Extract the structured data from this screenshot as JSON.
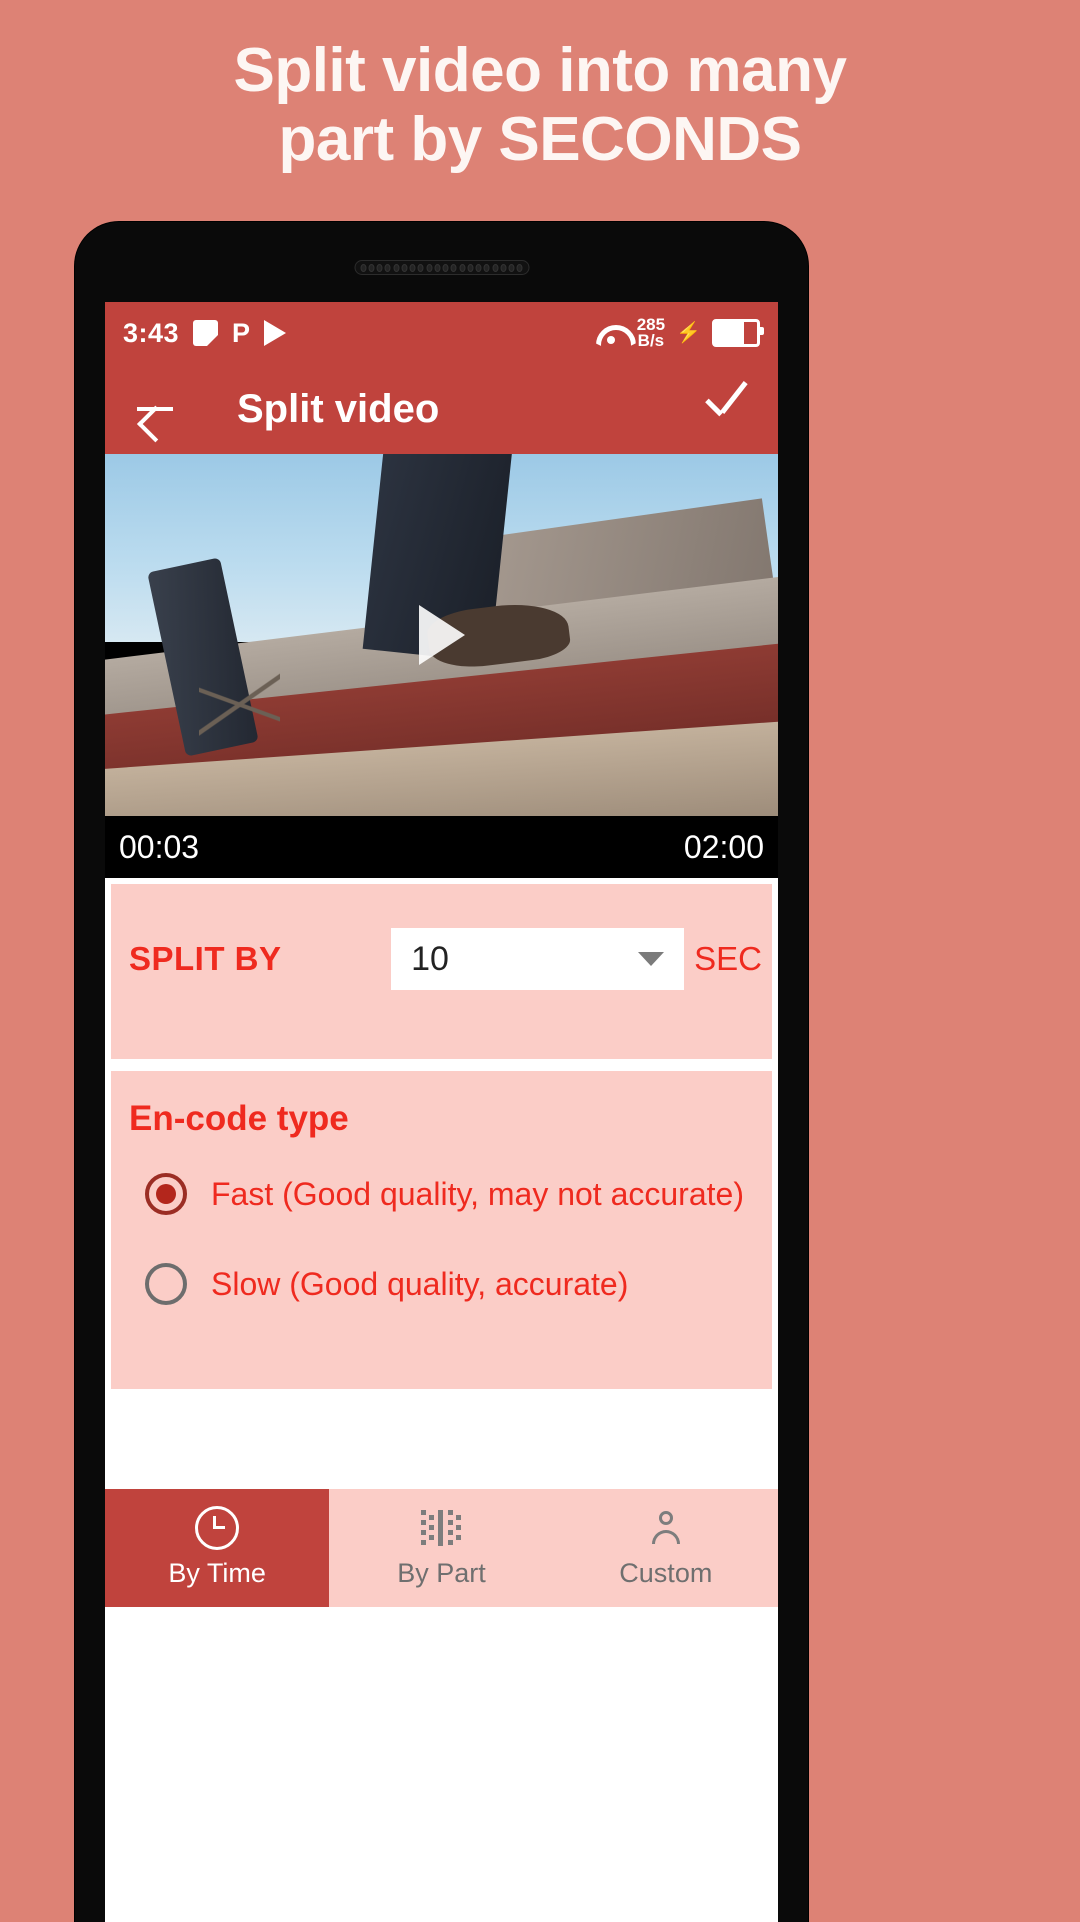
{
  "promo": {
    "line1": "Split video into many",
    "line2": "part by SECONDS"
  },
  "colors": {
    "background": "#dd8275",
    "toolbar": "#c0433d",
    "panel": "#fbcdc7",
    "accent": "#ef2a1f"
  },
  "status_bar": {
    "time": "3:43",
    "icons_left": [
      "screenshot-icon",
      "p-icon",
      "play-store-icon"
    ],
    "wifi_icon": "wifi-icon",
    "net_speed_value": "285",
    "net_speed_unit": "B/s",
    "charging_icon": "bolt-icon",
    "battery_icon": "battery-icon"
  },
  "toolbar": {
    "back_icon": "back-arrow-icon",
    "title": "Split video",
    "confirm_icon": "check-icon"
  },
  "video": {
    "play_icon": "play-icon",
    "current_time": "00:03",
    "total_time": "02:00"
  },
  "split_by": {
    "label": "SPLIT BY",
    "value": "10",
    "unit": "SEC",
    "caret_icon": "chevron-down-icon"
  },
  "encode": {
    "title": "En-code type",
    "options": [
      {
        "label": "Fast (Good quality, may not accurate)",
        "selected": true
      },
      {
        "label": "Slow (Good quality, accurate)",
        "selected": false
      }
    ]
  },
  "bottom_nav": {
    "items": [
      {
        "label": "By Time",
        "icon": "clock-icon",
        "active": true
      },
      {
        "label": "By Part",
        "icon": "parts-icon",
        "active": false
      },
      {
        "label": "Custom",
        "icon": "person-icon",
        "active": false
      }
    ]
  }
}
